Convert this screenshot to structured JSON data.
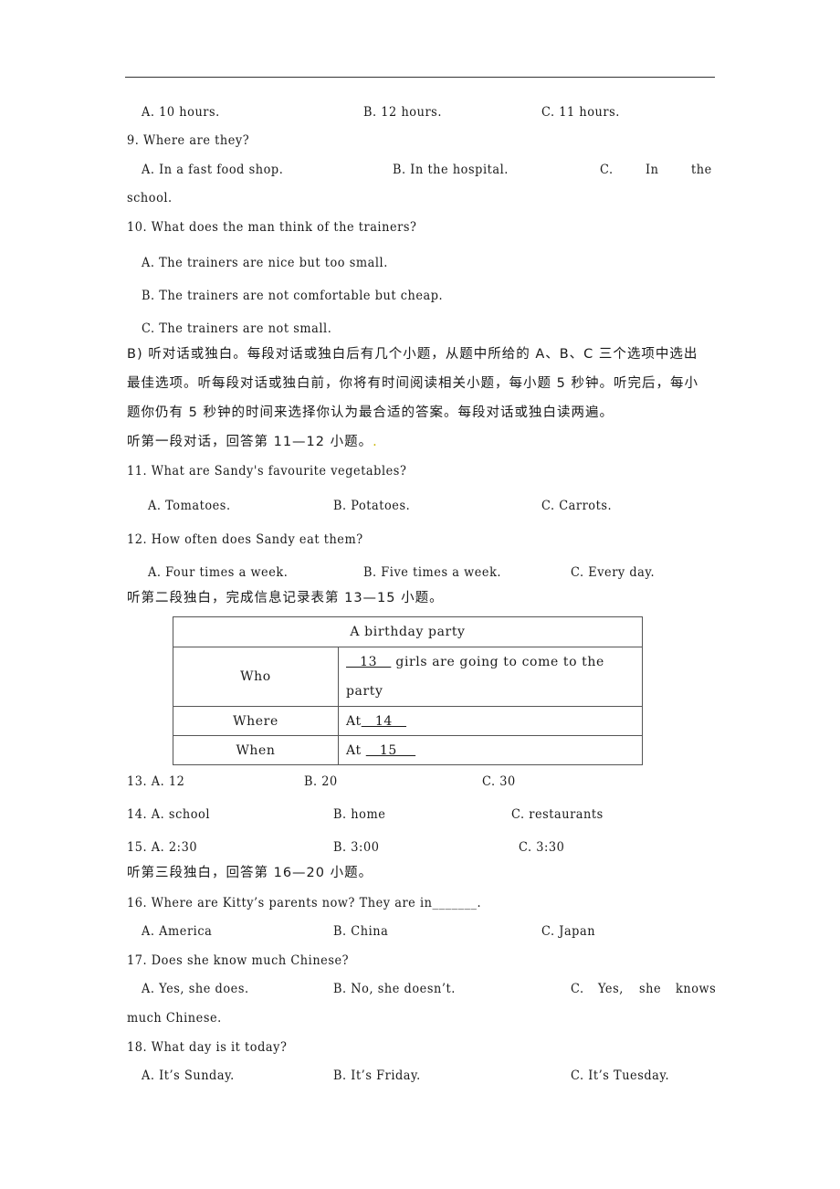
{
  "q8_options": [
    "A. 10 hours.",
    "B. 12 hours.",
    "C. 11 hours."
  ],
  "q9": {
    "question": "9. Where are they?",
    "a": "A. In a fast food shop.",
    "b": "B. In the hospital.",
    "c_parts": [
      "C.",
      "In",
      "the"
    ],
    "c_cont": "school."
  },
  "q10": {
    "question": "10. What does the man think of the trainers?",
    "a": "A. The trainers are nice but too small.",
    "b": "B. The trainers are not comfortable but cheap.",
    "c": "C. The trainers are not small."
  },
  "section_b": {
    "line1": "B) 听对话或独白。每段对话或独白后有几个小题，从题中所给的 A、B、C 三个选项中选出",
    "line2": "最佳选项。听每段对话或独白前，你将有时间阅读相关小题，每小题 5 秒钟。听完后，每小",
    "line3": "题你仍有 5 秒钟的时间来选择你认为最合适的答案。每段对话或独白读两遍。",
    "part1": "听第一段对话，回答第 11—12 小题。",
    "part1_dot": "."
  },
  "q11": {
    "question": "11. What are Sandy's favourite vegetables?",
    "options": [
      "A. Tomatoes.",
      "B. Potatoes.",
      "C. Carrots."
    ]
  },
  "q12": {
    "question": "12. How often does Sandy eat them?",
    "options": [
      "A. Four times a week.",
      "B. Five times a week.",
      "C. Every day."
    ]
  },
  "part2": "听第二段独白，完成信息记录表第 13—15 小题。",
  "table": {
    "title": "A birthday party",
    "rows": [
      {
        "label": "Who",
        "blank": "   13   ",
        "text": " girls are going to come to the",
        "text2": "party"
      },
      {
        "label": "Where",
        "prefix": "At",
        "blank": "   14   "
      },
      {
        "label": "When",
        "prefix": "At ",
        "blank": "   15    "
      }
    ]
  },
  "q13": {
    "num": "13. A. 12",
    "b": "B. 20",
    "c": "C. 30"
  },
  "q14": {
    "num": "14. A. school",
    "b": "B. home",
    "c": "C. restaurants"
  },
  "q15": {
    "num": "15. A. 2:30",
    "b": "B. 3:00",
    "c": "C. 3:30"
  },
  "part3": "听第三段独白，回答第 16—20 小题。",
  "q16": {
    "question": "16. Where are Kitty’s parents now? They are in_______.",
    "options": [
      "A. America",
      "B. China",
      "C. Japan"
    ]
  },
  "q17": {
    "question": "17. Does she know much Chinese?",
    "a": "A. Yes, she does.",
    "b": "B. No, she doesn’t.",
    "c_parts": [
      "C.",
      "Yes,",
      "she",
      "knows"
    ],
    "c_cont": "much Chinese."
  },
  "q18": {
    "question": "18. What day is it today?",
    "options": [
      "A. It’s Sunday.",
      "B. It’s Friday.",
      "C. It’s Tuesday."
    ]
  }
}
